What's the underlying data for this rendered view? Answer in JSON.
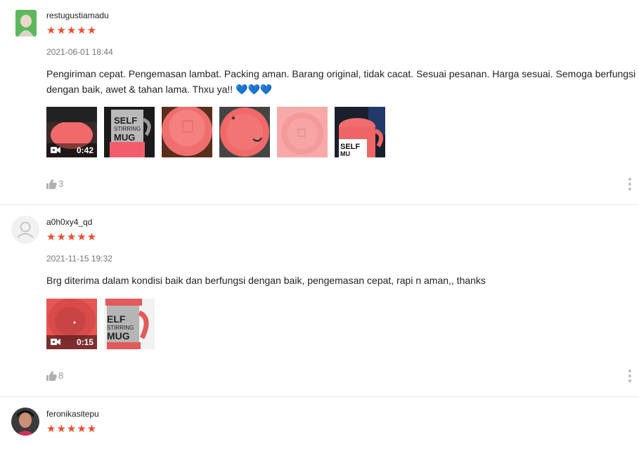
{
  "reviews": [
    {
      "username": "restugustiamadu",
      "stars": "★★★★★",
      "date": "2021-06-01 18:44",
      "text_line1": "Pengiriman cepat. Pengemasan lambat. Packing aman. Barang original, tidak cacat. Sesuai pesanan. Harga sesuai. Semoga berfungsi",
      "text_line2": "dengan baik, awet & tahan lama. Thxu ya!! ",
      "emoji": "💙💙💙",
      "video_duration": "0:42",
      "media_labels": [
        "SELF STIRRING MUG",
        "SELF MU"
      ],
      "likes": "3"
    },
    {
      "username": "a0h0xy4_qd",
      "stars": "★★★★★",
      "date": "2021-11-15 19:32",
      "text_line1": "Brg diterima dalam kondisi baik dan berfungsi dengan baik, pengemasan cepat, rapi n aman,, thanks",
      "video_duration": "0:15",
      "media_labels": [
        "SELF STIRRING MUG"
      ],
      "likes": "8"
    },
    {
      "username": "feronikasitepu",
      "stars": "★★★★★"
    }
  ],
  "colors": {
    "star": "#ee4d2d",
    "muted": "#757575",
    "like": "#999999",
    "divider": "#e5e5e5"
  },
  "icons": {
    "like": "thumbs-up-icon",
    "more": "more-vertical-icon",
    "video": "video-camera-icon",
    "avatar_default": "user-silhouette-icon"
  }
}
